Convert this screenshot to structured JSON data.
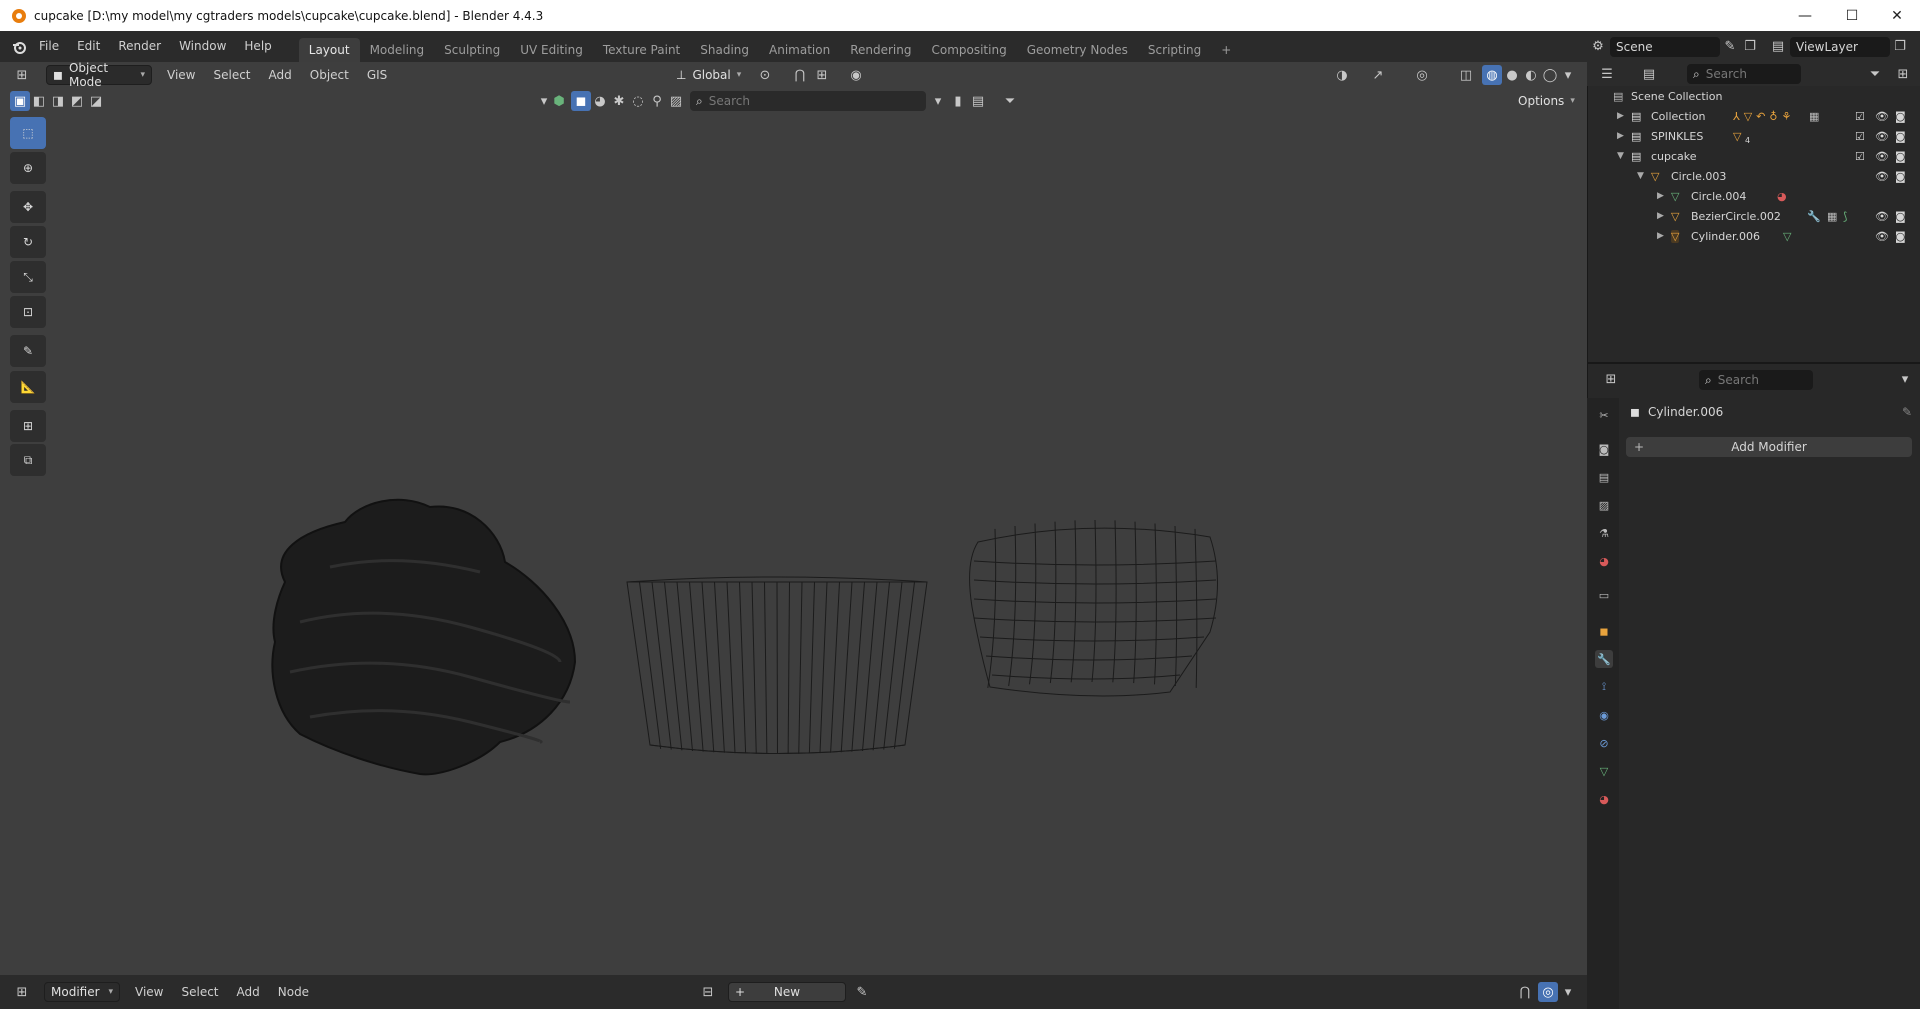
{
  "window": {
    "title": "cupcake [D:\\my model\\my cgtraders models\\cupcake\\cupcake.blend] - Blender 4.4.3",
    "minimize": "—",
    "maximize": "☐",
    "close": "✕"
  },
  "menu": [
    "File",
    "Edit",
    "Render",
    "Window",
    "Help"
  ],
  "workspaces": [
    "Layout",
    "Modeling",
    "Sculpting",
    "UV Editing",
    "Texture Paint",
    "Shading",
    "Animation",
    "Rendering",
    "Compositing",
    "Geometry Nodes",
    "Scripting",
    "+"
  ],
  "active_workspace": "Layout",
  "scene": {
    "label": "Scene"
  },
  "view_layer": {
    "label": "ViewLayer"
  },
  "viewport_header": {
    "mode": "Object Mode",
    "menus": [
      "View",
      "Select",
      "Add",
      "Object",
      "GIS"
    ],
    "transform_orientation": "Global",
    "search_placeholder": "Search",
    "options": "Options"
  },
  "outliner": {
    "search_placeholder": "Search",
    "root": "Scene Collection",
    "rows": [
      {
        "name": "Collection",
        "badge": ""
      },
      {
        "name": "SPINKLES",
        "badge": "4"
      },
      {
        "name": "cupcake",
        "badge": ""
      },
      {
        "name": "Circle.003",
        "badge": ""
      },
      {
        "name": "Circle.004",
        "badge": ""
      },
      {
        "name": "BezierCircle.002",
        "badge": ""
      },
      {
        "name": "Cylinder.006",
        "badge": ""
      }
    ]
  },
  "properties": {
    "search_placeholder": "Search",
    "object_name": "Cylinder.006",
    "add_modifier": "Add Modifier"
  },
  "bottom_header": {
    "editor": "Modifier",
    "menus": [
      "View",
      "Select",
      "Add",
      "Node"
    ],
    "new_button": "New"
  },
  "colors": {
    "accent": "#4772b3",
    "orange": "#e87d0d",
    "mesh_green": "#69b37b",
    "viewport_bg": "#3e3e3e"
  }
}
